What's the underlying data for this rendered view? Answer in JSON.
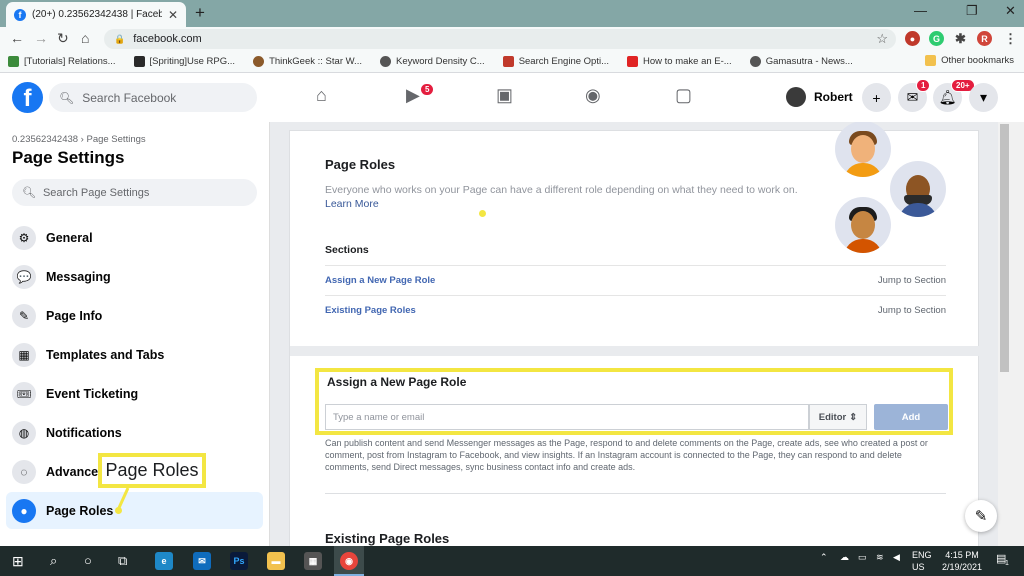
{
  "browser": {
    "tab_title": "(20+) 0.23562342438 | Facebook",
    "url": "facebook.com",
    "bookmarks": [
      {
        "label": "[Tutorials] Relations...",
        "color": "#3c8b3c"
      },
      {
        "label": "[Spriting]Use RPG...",
        "color": "#2a2a2a"
      },
      {
        "label": "ThinkGeek :: Star W...",
        "color": "#8b5a2b"
      },
      {
        "label": "Keyword Density C...",
        "color": "#555555"
      },
      {
        "label": "Search Engine Opti...",
        "color": "#c0392b"
      },
      {
        "label": "How to make an E-...",
        "color": "#e02424"
      },
      {
        "label": "Gamasutra - News...",
        "color": "#555555"
      }
    ],
    "other_bookmarks": "Other bookmarks",
    "profile_initial": "R"
  },
  "fb": {
    "logo": "f",
    "search_placeholder": "Search Facebook",
    "video_badge": "5",
    "profile_name": "Robert",
    "messenger_badge": "1",
    "notif_badge": "20+"
  },
  "sidebar": {
    "breadcrumb": "0.23562342438 › Page Settings",
    "title": "Page Settings",
    "search_placeholder": "Search Page Settings",
    "items": [
      {
        "label": "General",
        "icon": "gear-icon",
        "glyph": "⚙"
      },
      {
        "label": "Messaging",
        "icon": "chat-icon",
        "glyph": "💬"
      },
      {
        "label": "Page Info",
        "icon": "pencil-icon",
        "glyph": "✎"
      },
      {
        "label": "Templates and Tabs",
        "icon": "grid-icon",
        "glyph": "▦"
      },
      {
        "label": "Event Ticketing",
        "icon": "ticket-icon",
        "glyph": "🎟"
      },
      {
        "label": "Notifications",
        "icon": "globe-icon",
        "glyph": "◍"
      },
      {
        "label": "Advance",
        "icon": "messenger-icon",
        "glyph": "◌"
      },
      {
        "label": "Page Roles",
        "icon": "person-icon",
        "glyph": "●"
      }
    ]
  },
  "main": {
    "title": "Page Roles",
    "description": "Everyone who works on your Page can have a different role depending on what they need to work on.",
    "learn_more": "Learn More",
    "sections_heading": "Sections",
    "sections": [
      {
        "label": "Assign a New Page Role",
        "jump": "Jump to Section"
      },
      {
        "label": "Existing Page Roles",
        "jump": "Jump to Section"
      }
    ],
    "assign": {
      "title": "Assign a New Page Role",
      "input_placeholder": "Type a name or email",
      "role": "Editor",
      "add_label": "Add",
      "help": "Can publish content and send Messenger messages as the Page, respond to and delete comments on the Page, create ads, see who created a post or comment, post from Instagram to Facebook, and view insights. If an Instagram account is connected to the Page, they can respond to and delete comments, send Direct messages, sync business contact info and create ads."
    },
    "existing_title": "Existing Page Roles"
  },
  "callout": "Page Roles",
  "taskbar": {
    "lang_top": "ENG",
    "lang_bottom": "US",
    "time": "4:15 PM",
    "date": "2/19/2021",
    "notif_count": "1"
  },
  "colors": {
    "fb_blue": "#1877f2",
    "highlight_yellow": "#f3e642",
    "link": "#4267b2"
  }
}
